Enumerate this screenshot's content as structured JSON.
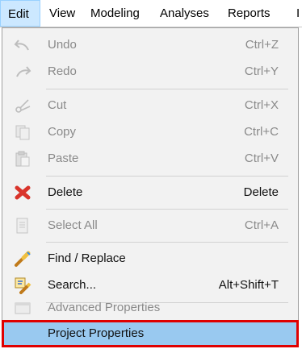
{
  "menubar": {
    "items": [
      {
        "label": "Edit"
      },
      {
        "label": "View"
      },
      {
        "label": "Modeling"
      },
      {
        "label": "Analyses"
      },
      {
        "label": "Reports"
      },
      {
        "label": "I"
      }
    ]
  },
  "edit_menu": {
    "items": [
      {
        "label": "Undo",
        "shortcut": "Ctrl+Z",
        "icon": "undo-icon",
        "enabled": false
      },
      {
        "label": "Redo",
        "shortcut": "Ctrl+Y",
        "icon": "redo-icon",
        "enabled": false
      },
      {
        "label": "Cut",
        "shortcut": "Ctrl+X",
        "icon": "cut-icon",
        "enabled": false
      },
      {
        "label": "Copy",
        "shortcut": "Ctrl+C",
        "icon": "copy-icon",
        "enabled": false
      },
      {
        "label": "Paste",
        "shortcut": "Ctrl+V",
        "icon": "paste-icon",
        "enabled": false
      },
      {
        "label": "Delete",
        "shortcut": "Delete",
        "icon": "delete-icon",
        "enabled": true
      },
      {
        "label": "Select All",
        "shortcut": "Ctrl+A",
        "icon": "select-all-icon",
        "enabled": false
      },
      {
        "label": "Find / Replace",
        "shortcut": "",
        "icon": "find-replace-icon",
        "enabled": true
      },
      {
        "label": "Search...",
        "shortcut": "Alt+Shift+T",
        "icon": "search-icon",
        "enabled": true
      },
      {
        "label": "Advanced Properties",
        "shortcut": "",
        "icon": "advanced-properties-icon",
        "enabled": false
      },
      {
        "label": "Project Properties",
        "shortcut": "",
        "icon": "",
        "enabled": true,
        "selected": true
      }
    ]
  },
  "colors": {
    "highlight_border": "#e00000",
    "selected_bg": "#99c9f0",
    "menu_bg": "#f2f2f2",
    "active_menubar_bg": "#cce8ff"
  }
}
